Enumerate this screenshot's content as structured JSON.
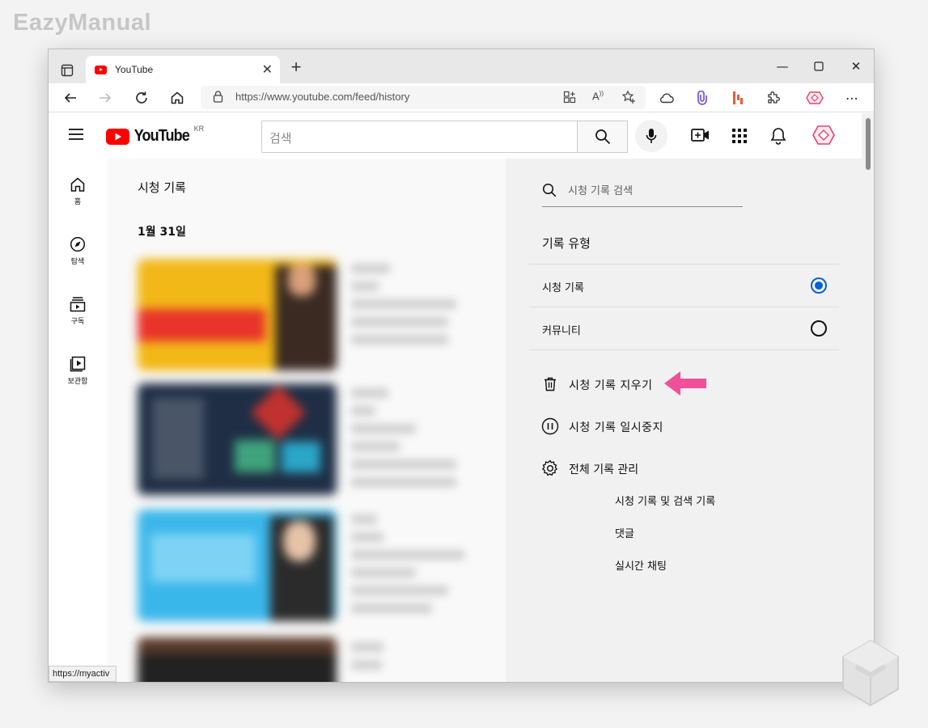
{
  "watermark": "EazyManual",
  "browser": {
    "tab_title": "YouTube",
    "url": "https://www.youtube.com/feed/history",
    "status_tooltip": "https://myactiv"
  },
  "youtube": {
    "logo_text": "YouTube",
    "region": "KR",
    "search_placeholder": "검색",
    "sidebar": [
      {
        "label": "홈",
        "icon": "home-icon"
      },
      {
        "label": "탐색",
        "icon": "explore-icon"
      },
      {
        "label": "구독",
        "icon": "subscriptions-icon"
      },
      {
        "label": "보관함",
        "icon": "library-icon"
      }
    ],
    "page_title": "시청 기록",
    "date_header": "1월 31일",
    "panel": {
      "history_search_placeholder": "시청 기록 검색",
      "history_type_title": "기록 유형",
      "types": [
        {
          "label": "시청 기록",
          "selected": true
        },
        {
          "label": "커뮤니티",
          "selected": false
        }
      ],
      "clear_label": "시청 기록 지우기",
      "pause_label": "시청 기록 일시중지",
      "manage_label": "전체 기록 관리",
      "manage_items": [
        "시청 기록 및 검색 기록",
        "댓글",
        "실시간 채팅"
      ]
    }
  },
  "colors": {
    "accent_blue": "#065fd4",
    "youtube_red": "#ff0000",
    "arrow_pink": "#f0509a"
  }
}
